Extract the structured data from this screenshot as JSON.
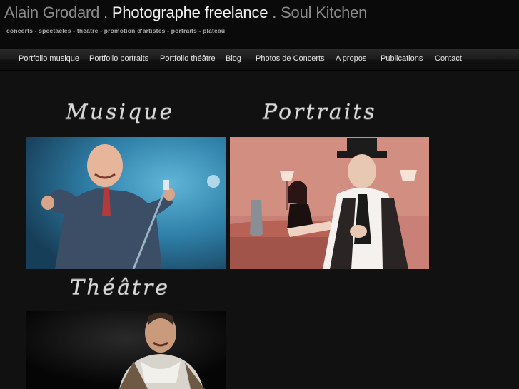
{
  "header": {
    "name": "Alain Grodard",
    "sep1": " . ",
    "main": "Photographe freelance",
    "sep2": " . ",
    "kitchen": "Soul Kitchen",
    "tagline": "concerts - spectacles - théâtre - promotion d'artistes - portraits - plateau"
  },
  "nav": {
    "items": [
      {
        "label": "Portfolio musique"
      },
      {
        "label": "Portfolio portraits"
      },
      {
        "label": "Portfolio théâtre"
      },
      {
        "label": "Blog"
      },
      {
        "label": "Photos de Concerts"
      },
      {
        "label": "A propos"
      },
      {
        "label": "Publications"
      },
      {
        "label": "Contact"
      }
    ]
  },
  "sections": {
    "musique": {
      "title": "Musique"
    },
    "portraits": {
      "title": "Portraits"
    },
    "theatre": {
      "title": "Théâtre"
    }
  },
  "colors": {
    "background": "#111111",
    "header_muted": "#8a8a8a",
    "header_main": "#f2f2f2"
  }
}
